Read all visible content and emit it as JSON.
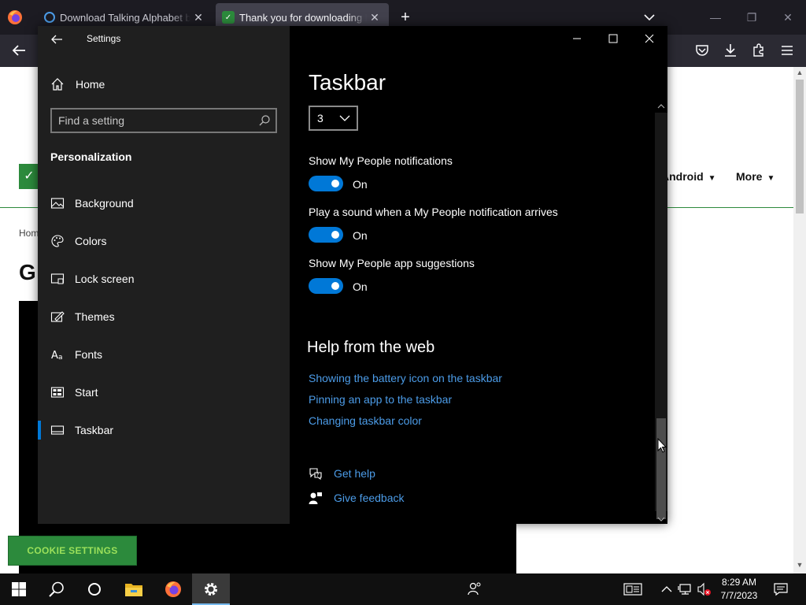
{
  "browser": {
    "tabs": [
      {
        "title": "Download Talking Alphabet by",
        "favicon": "search-favicon",
        "favicon_color": "#4c9ce8"
      },
      {
        "title": "Thank you for downloading Mi",
        "favicon": "green-check-favicon",
        "favicon_color": "#2c8a3c",
        "active": true
      }
    ],
    "new_tab_icon": "plus-icon"
  },
  "webpage": {
    "nav_items": [
      "Android",
      "More"
    ],
    "breadcrumb": "Hom",
    "title_fragment": "G",
    "cookie_button": "COOKIE SETTINGS",
    "brand_color": "#2c8a3c"
  },
  "settings": {
    "app_title": "Settings",
    "home_label": "Home",
    "search_placeholder": "Find a setting",
    "section_title": "Personalization",
    "nav_items": [
      {
        "label": "Background",
        "icon": "picture-icon"
      },
      {
        "label": "Colors",
        "icon": "palette-icon"
      },
      {
        "label": "Lock screen",
        "icon": "lock-screen-icon"
      },
      {
        "label": "Themes",
        "icon": "themes-icon"
      },
      {
        "label": "Fonts",
        "icon": "fonts-icon"
      },
      {
        "label": "Start",
        "icon": "start-icon"
      },
      {
        "label": "Taskbar",
        "icon": "taskbar-icon",
        "active": true
      }
    ],
    "page_title": "Taskbar",
    "dropdown_value": "3",
    "toggles": [
      {
        "label": "Show My People notifications",
        "state": "On",
        "on": true
      },
      {
        "label": "Play a sound when a My People notification arrives",
        "state": "On",
        "on": true
      },
      {
        "label": "Show My People app suggestions",
        "state": "On",
        "on": true
      }
    ],
    "help_title": "Help from the web",
    "help_links": [
      "Showing the battery icon on the taskbar",
      "Pinning an app to the taskbar",
      "Changing taskbar color"
    ],
    "support": [
      {
        "label": "Get help",
        "icon": "get-help-icon"
      },
      {
        "label": "Give feedback",
        "icon": "feedback-icon"
      }
    ],
    "accent_color": "#0078d7",
    "link_color": "#4c9ce8"
  },
  "taskbar": {
    "time": "8:29 AM",
    "date": "7/7/2023"
  }
}
